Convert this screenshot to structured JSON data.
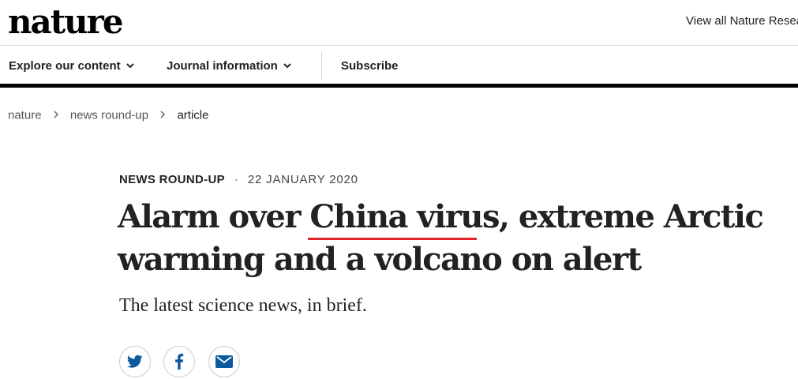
{
  "header": {
    "logo": "nature",
    "view_all": "View all Nature Research journals"
  },
  "nav": {
    "explore": "Explore our content",
    "journal": "Journal information",
    "subscribe": "Subscribe"
  },
  "breadcrumb": [
    "nature",
    "news round-up",
    "article"
  ],
  "article": {
    "type": "NEWS ROUND-UP",
    "separator": "·",
    "date": "22 JANUARY 2020",
    "title": "Alarm over China virus, extreme Arctic warming and a volcano on alert",
    "standfirst": "The latest science news, in brief."
  },
  "share": {
    "icons": [
      "twitter-icon",
      "facebook-icon",
      "email-icon"
    ]
  },
  "colors": {
    "accent_underline": "#e0242a",
    "share_icon": "#0c5a9e",
    "text": "#222222"
  }
}
